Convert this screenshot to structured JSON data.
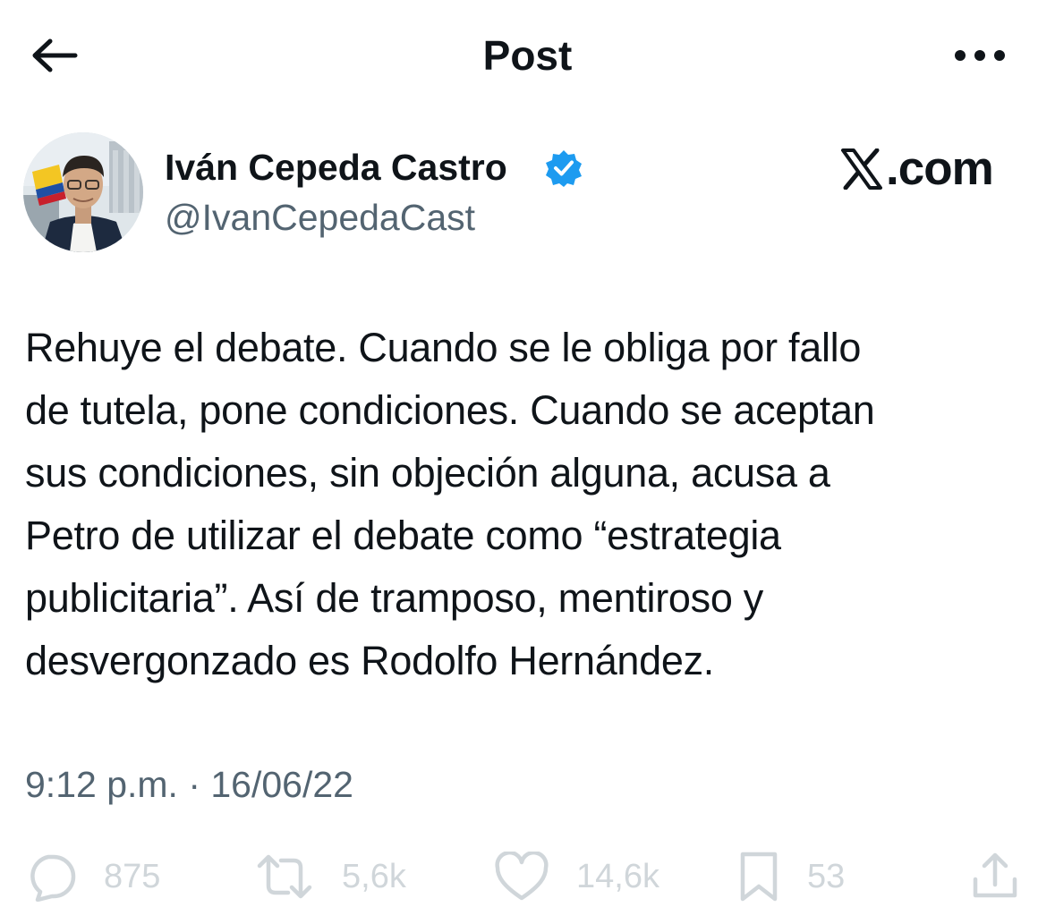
{
  "header": {
    "title": "Post",
    "back_icon": "arrow-left-icon",
    "more_icon": "more-horizontal-icon"
  },
  "author": {
    "name": "Iván Cepeda Castro",
    "handle": "@IvanCepedaCast",
    "verified": true,
    "verified_color": "#1d9bf0"
  },
  "brand": {
    "text": ".com",
    "icon": "x-logo-icon"
  },
  "tweet": {
    "lines": [
      "Rehuye el debate. Cuando se le obliga por fallo",
      "de tutela, pone condiciones. Cuando se aceptan",
      "sus condiciones, sin objeción alguna, acusa a",
      "Petro de utilizar el debate como “estrategia",
      "publicitaria”. Así de tramposo, mentiroso y",
      "desvergonzado es Rodolfo Hernández."
    ]
  },
  "meta": {
    "timestamp": "9:12 p.m. · 16/06/22"
  },
  "actions": {
    "reply": {
      "icon": "reply-icon",
      "count": "875"
    },
    "retweet": {
      "icon": "retweet-icon",
      "count": "5,6k"
    },
    "like": {
      "icon": "heart-icon",
      "count": "14,6k"
    },
    "bookmark": {
      "icon": "bookmark-icon",
      "count": "53"
    },
    "share": {
      "icon": "share-icon"
    }
  },
  "colors": {
    "text": "#0f1419",
    "secondary": "#536471",
    "action_faded": "#d0d6da"
  }
}
